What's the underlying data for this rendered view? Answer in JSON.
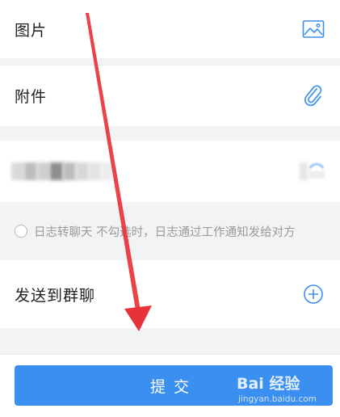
{
  "rows": {
    "image": {
      "label": "图片",
      "icon": "image-icon"
    },
    "attachment": {
      "label": "附件",
      "icon": "paperclip-icon"
    },
    "forward_group": {
      "label": "发送到群聊",
      "icon": "add-circle-icon"
    }
  },
  "notice": {
    "text": "日志转聊天 不勾选时，日志通过工作通知发给对方"
  },
  "submit": {
    "label": "提交"
  },
  "watermark": {
    "main": "Bai 经验",
    "sub": "jingyan.baidu.com"
  },
  "colors": {
    "accent": "#3b8ff0",
    "annotation_arrow": "#e8323a",
    "background": "#f2f3f5"
  }
}
